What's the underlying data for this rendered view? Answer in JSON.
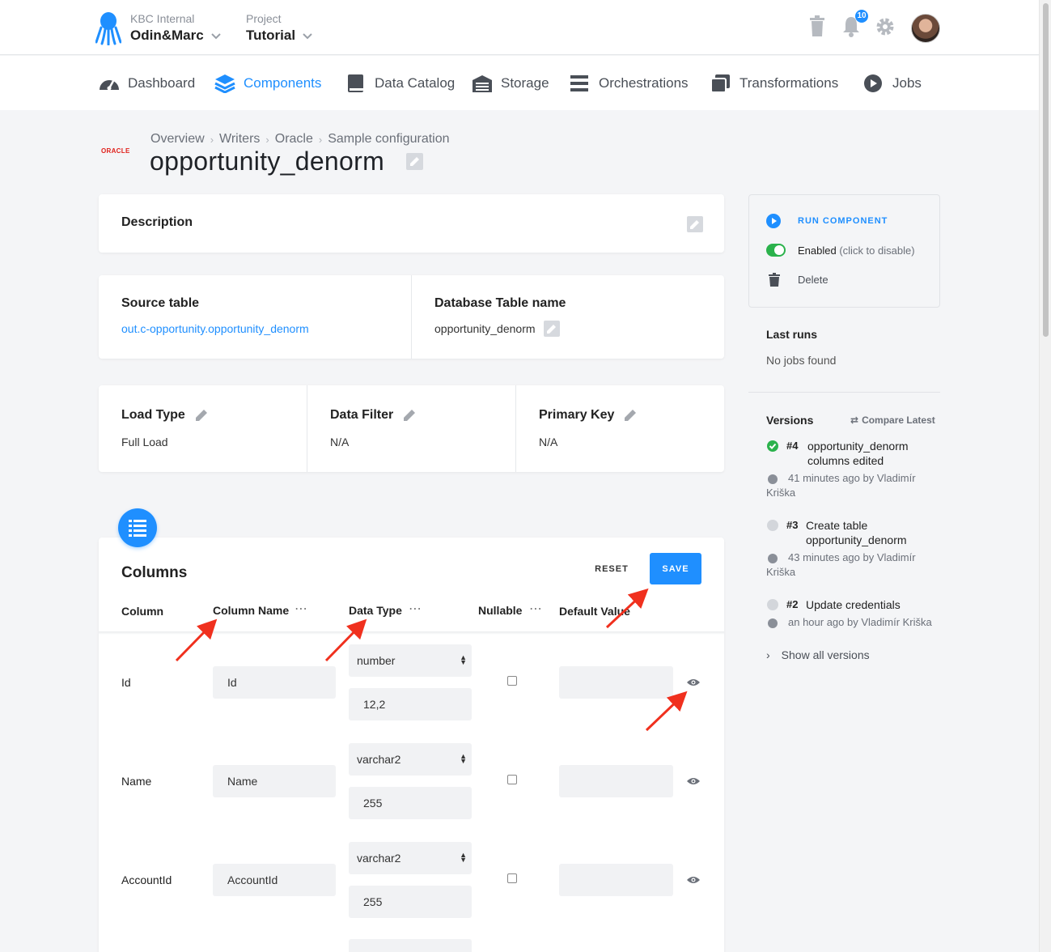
{
  "header": {
    "org_label": "KBC Internal",
    "org_value": "Odin&Marc",
    "project_label": "Project",
    "project_value": "Tutorial",
    "notification_count": "10"
  },
  "nav": [
    {
      "label": "Dashboard"
    },
    {
      "label": "Components"
    },
    {
      "label": "Data Catalog"
    },
    {
      "label": "Storage"
    },
    {
      "label": "Orchestrations"
    },
    {
      "label": "Transformations"
    },
    {
      "label": "Jobs"
    }
  ],
  "breadcrumb": [
    "Overview",
    "Writers",
    "Oracle",
    "Sample configuration"
  ],
  "component_logo_text": "ORACLE",
  "title": "opportunity_denorm",
  "description": {
    "label": "Description"
  },
  "source": {
    "label": "Source table",
    "value": "out.c-opportunity.opportunity_denorm",
    "db_label": "Database Table name",
    "db_value": "opportunity_denorm"
  },
  "load": {
    "load_type_label": "Load Type",
    "load_type_value": "Full Load",
    "filter_label": "Data Filter",
    "filter_value": "N/A",
    "pk_label": "Primary Key",
    "pk_value": "N/A"
  },
  "columns": {
    "title": "Columns",
    "reset_label": "RESET",
    "save_label": "SAVE",
    "headers": [
      "Column",
      "Column Name",
      "Data Type",
      "Nullable",
      "Default Value"
    ],
    "rows": [
      {
        "column": "Id",
        "name": "Id",
        "type": "number",
        "size": "12,2"
      },
      {
        "column": "Name",
        "name": "Name",
        "type": "varchar2",
        "size": "255"
      },
      {
        "column": "AccountId",
        "name": "AccountId",
        "type": "varchar2",
        "size": "255"
      }
    ]
  },
  "sidebar": {
    "run_label": "RUN COMPONENT",
    "enabled_label": "Enabled",
    "enabled_hint": "(click to disable)",
    "delete_label": "Delete",
    "last_runs_label": "Last runs",
    "last_runs_value": "No jobs found",
    "versions_label": "Versions",
    "compare_label": "Compare Latest",
    "versions": [
      {
        "num": "#4",
        "desc1": "opportunity_denorm",
        "desc2": "columns edited",
        "meta1": "41 minutes ago by Vladimír",
        "meta2": "Kriška"
      },
      {
        "num": "#3",
        "desc1": "Create table",
        "desc2": "opportunity_denorm",
        "meta1": "43 minutes ago by Vladimír",
        "meta2": "Kriška"
      },
      {
        "num": "#2",
        "desc1": "Update credentials",
        "desc2": "",
        "meta1": "an hour ago by Vladimír Kriška",
        "meta2": ""
      }
    ],
    "show_all_label": "Show all versions"
  },
  "colors": {
    "accent": "#1f8fff",
    "success": "#2bb24c",
    "arrow": "#f0301e"
  }
}
